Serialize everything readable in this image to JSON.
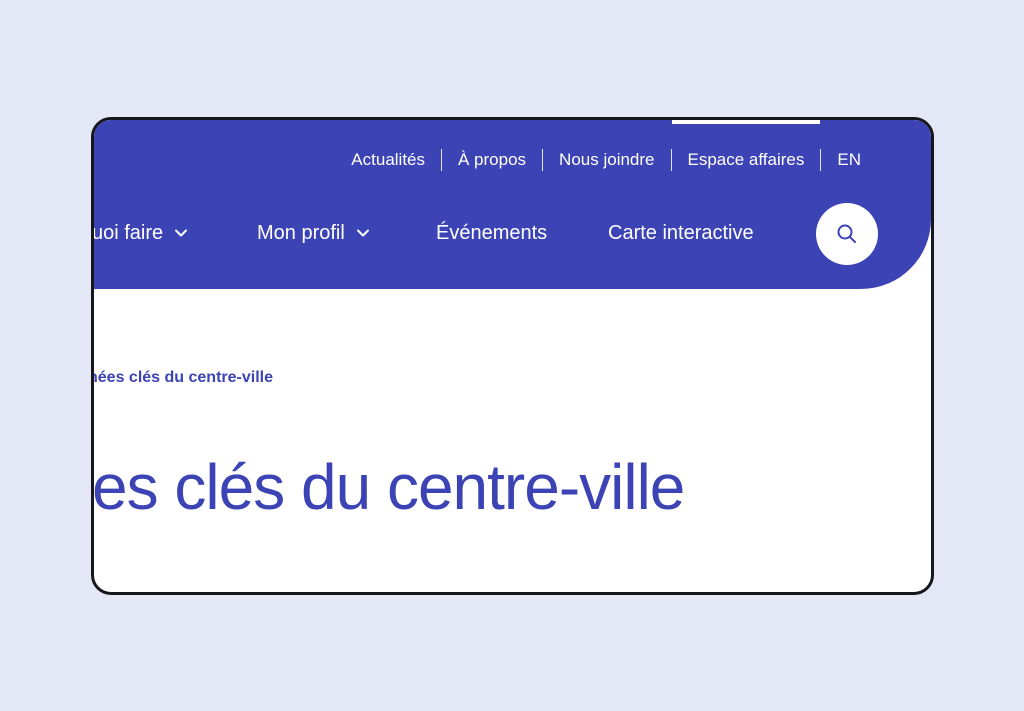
{
  "colors": {
    "background": "#e4e7f6",
    "brand": "#3b43b5",
    "frame_border": "#16161c"
  },
  "utility_nav": {
    "items": [
      "Actualités",
      "À propos",
      "Nous joindre",
      "Espace affaires"
    ],
    "active_item": "Espace affaires",
    "language": "EN"
  },
  "main_nav": {
    "items": [
      {
        "label": "uoi faire",
        "has_dropdown": true
      },
      {
        "label": "Mon profil",
        "has_dropdown": true
      },
      {
        "label": "Événements",
        "has_dropdown": false
      },
      {
        "label": "Carte interactive",
        "has_dropdown": false
      }
    ],
    "search_icon": "search-icon"
  },
  "breadcrumb": {
    "text": "nées clés du centre-ville"
  },
  "page": {
    "title": "es clés du centre-ville"
  }
}
